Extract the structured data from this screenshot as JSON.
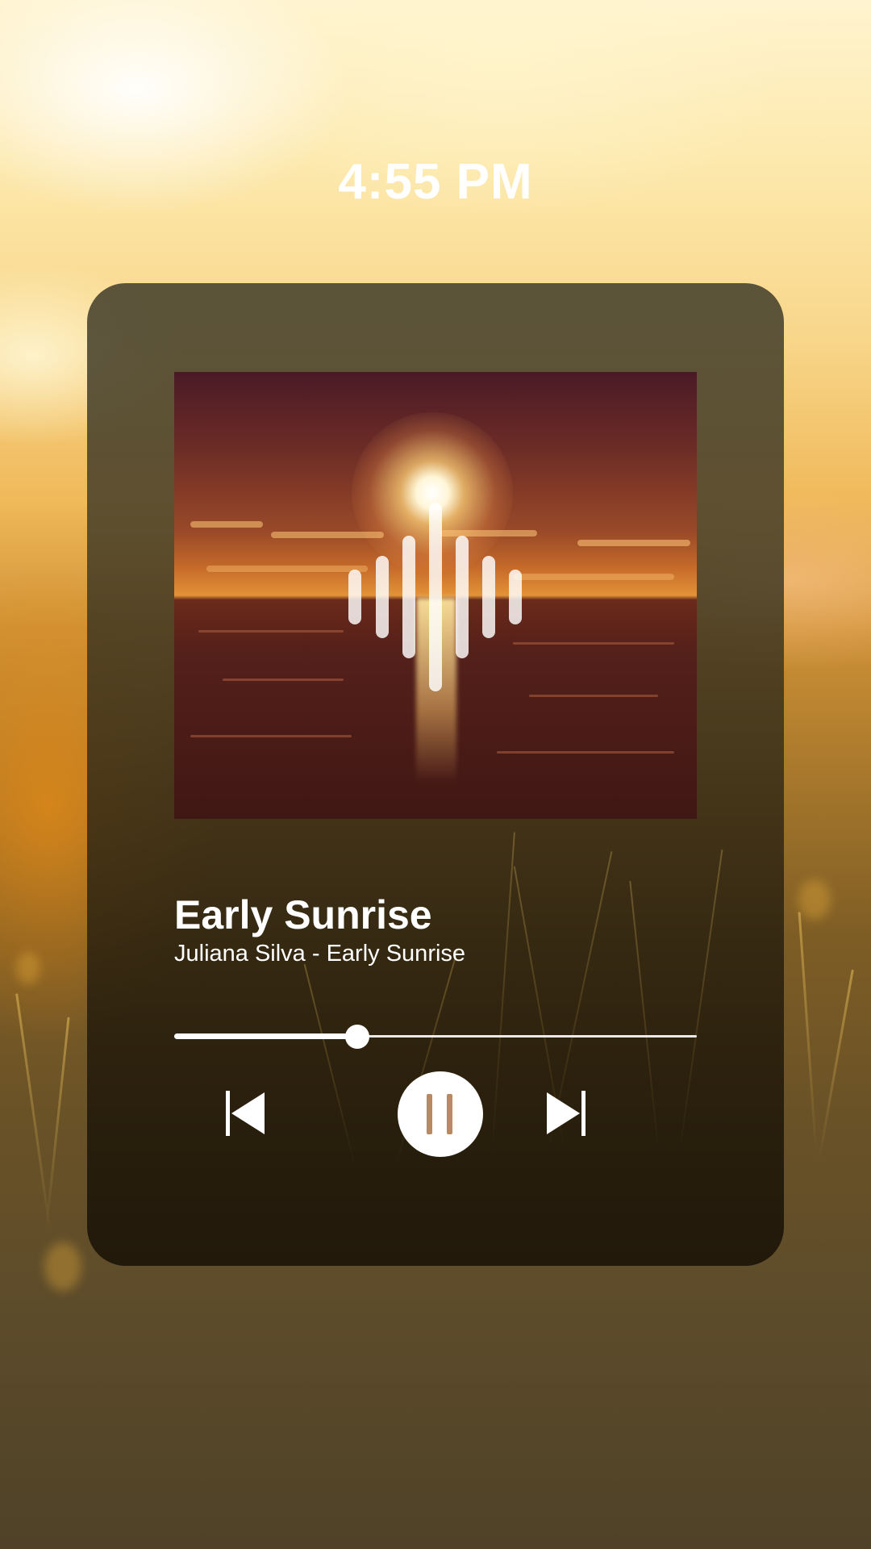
{
  "status": {
    "time": "4:55 PM"
  },
  "player": {
    "track_title": "Early Sunrise",
    "track_subtitle": "Juliana Silva - Early Sunrise",
    "progress_fraction": 0.35,
    "controls": {
      "previous_icon": "skip-previous-icon",
      "pause_icon": "pause-icon",
      "next_icon": "skip-next-icon"
    }
  },
  "colors": {
    "text": "#ffffff",
    "pause_bars": "#b98a62",
    "card_tint": "#3a3220"
  }
}
